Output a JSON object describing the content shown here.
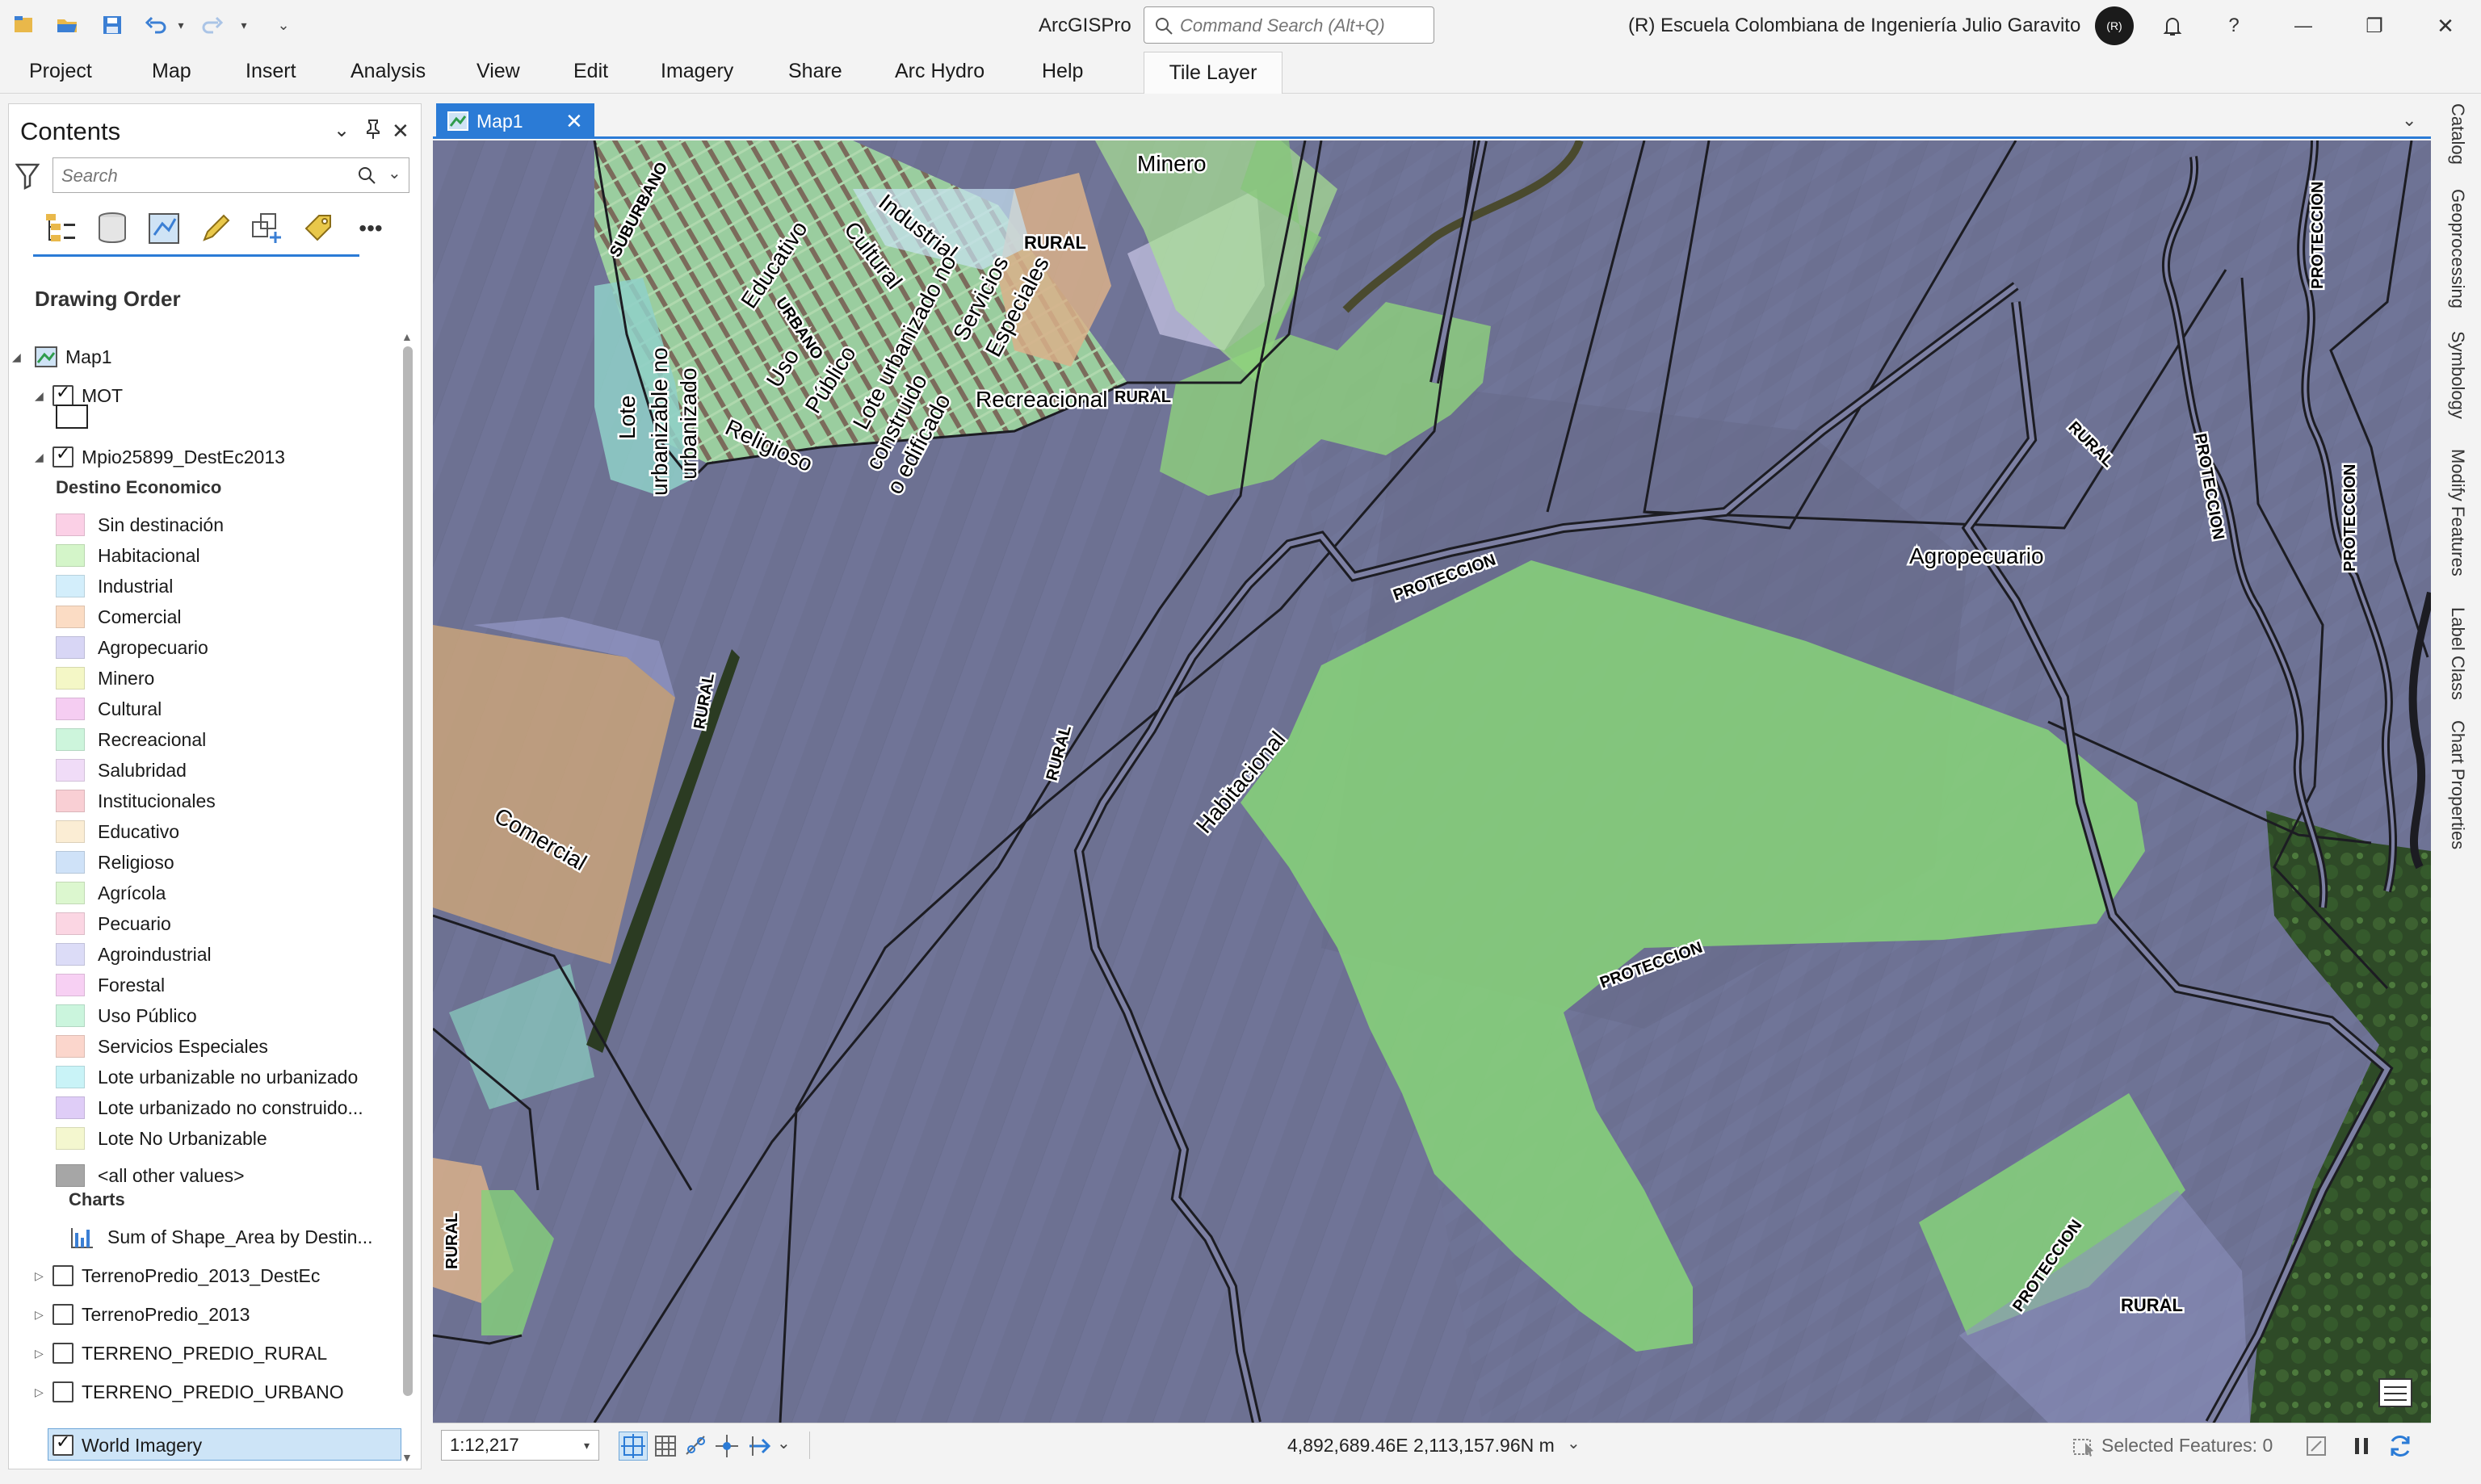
{
  "app": {
    "title": "ArcGISPro",
    "command_search_placeholder": "Command Search (Alt+Q)",
    "org": "(R)  Escuela Colombiana de Ingeniería Julio Garavito",
    "avatar_initials": "(R)"
  },
  "window_controls": {
    "help": "?",
    "minimize": "—",
    "restore": "❐",
    "close": "✕"
  },
  "ribbon": {
    "tabs": [
      "Project",
      "Map",
      "Insert",
      "Analysis",
      "View",
      "Edit",
      "Imagery",
      "Share",
      "Arc Hydro",
      "Help"
    ],
    "contextual_tab": "Tile Layer"
  },
  "contents": {
    "title": "Contents",
    "search_placeholder": "Search",
    "heading": "Drawing Order",
    "map_name": "Map1",
    "layer_mot": "MOT",
    "layer_main": "Mpio25899_DestEc2013",
    "field_heading": "Destino Economico",
    "legend": [
      {
        "label": "Sin destinación",
        "color": "#fbd0e6"
      },
      {
        "label": "Habitacional",
        "color": "#d4f5c9"
      },
      {
        "label": "Industrial",
        "color": "#d3eefb"
      },
      {
        "label": "Comercial",
        "color": "#fbdcc4"
      },
      {
        "label": "Agropecuario",
        "color": "#d8d6f5"
      },
      {
        "label": "Minero",
        "color": "#f4f7c6"
      },
      {
        "label": "Cultural",
        "color": "#f5cdf2"
      },
      {
        "label": "Recreacional",
        "color": "#cdf5dc"
      },
      {
        "label": "Salubridad",
        "color": "#f0dcf7"
      },
      {
        "label": "Institucionales",
        "color": "#f9cfd4"
      },
      {
        "label": "Educativo",
        "color": "#fbedd4"
      },
      {
        "label": "Religioso",
        "color": "#cfe2f8"
      },
      {
        "label": "Agrícola",
        "color": "#dcf7cf"
      },
      {
        "label": "Pecuario",
        "color": "#fbd6e3"
      },
      {
        "label": "Agroindustrial",
        "color": "#dcdcf7"
      },
      {
        "label": "Forestal",
        "color": "#f7d0f3"
      },
      {
        "label": "Uso Público",
        "color": "#cbf5dd"
      },
      {
        "label": "Servicios Especiales",
        "color": "#fbd6cc"
      },
      {
        "label": "Lote urbanizable no urbanizado",
        "color": "#c9f3f7"
      },
      {
        "label": "Lote urbanizado no construido...",
        "color": "#dfcdf7"
      },
      {
        "label": "Lote No Urbanizable",
        "color": "#f4f7cf"
      },
      {
        "label": "<all other values>",
        "color": "#a6a6a6"
      }
    ],
    "charts_heading": "Charts",
    "chart_item": "Sum of Shape_Area by Destin...",
    "other_layers": [
      "TerrenoPredio_2013_DestEc",
      "TerrenoPredio_2013",
      "TERRENO_PREDIO_RURAL",
      "TERRENO_PREDIO_URBANO"
    ],
    "basemap_layer": "World Imagery"
  },
  "map": {
    "tab_label": "Map1",
    "labels": {
      "minero": "Minero",
      "rural_top": "RURAL",
      "suburbano": "SUBURBANO",
      "industrial": "Industrial",
      "cultural": "Cultural",
      "educativo": "Educativo",
      "urbano": "URBANO",
      "uso_publico": "Uso\nPúblico",
      "lote_urb": "Lote\nurbanizable no\nurbanizado",
      "lote_no_const": "Lote urbanizado no\nconstruido\no edificado",
      "servicios": "Servicios\nEspeciales",
      "religioso": "Religioso",
      "recreacional": "Recreacional",
      "rural_rec": "RURAL",
      "proteccion_1": "PROTECCION",
      "agropecuario": "Agropecuario",
      "rural_right": "RURAL",
      "proteccion_right1": "PROTECCION",
      "proteccion_right2": "PROTECCION",
      "proteccion_right3": "PROTECCION",
      "rural_left": "RURAL",
      "comercial": "Comercial",
      "rural_mid": "RURAL",
      "habitacional": "Habitacional",
      "proteccion_mid": "PROTECCION",
      "rural_bl": "RURAL",
      "proteccion_br": "PROTECCION",
      "rural_br": "RURAL"
    }
  },
  "status": {
    "scale": "1:12,217",
    "coordinates": "4,892,689.46E 2,113,157.96N m",
    "selected_features": "Selected Features: 0"
  },
  "right_dock": [
    "Catalog",
    "Geoprocessing",
    "Symbology",
    "Modify Features",
    "Label Class",
    "Chart Properties"
  ]
}
